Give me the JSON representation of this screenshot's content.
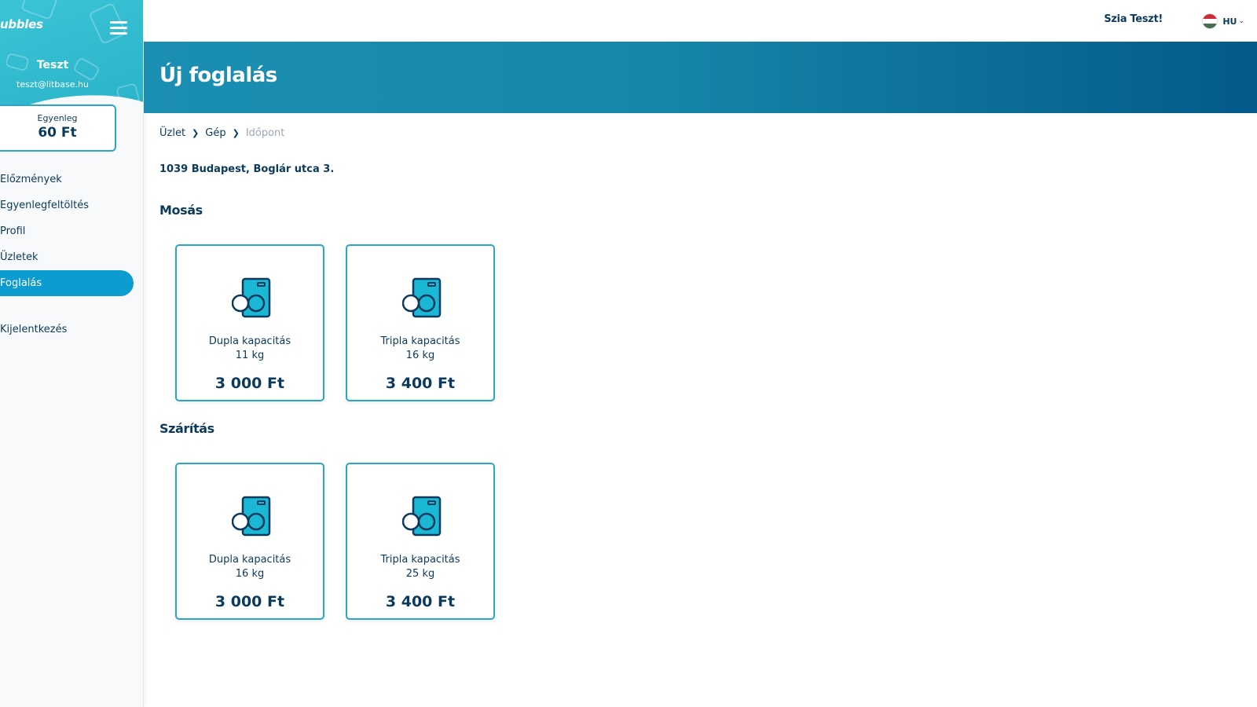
{
  "sidebar": {
    "logo": "ubbles",
    "user_name": "Teszt",
    "user_email": "teszt@litbase.hu",
    "balance_label": "Egyenleg",
    "balance_value": "60 Ft",
    "nav": [
      {
        "label": "Előzmények"
      },
      {
        "label": "Egyenlegfeltöltés"
      },
      {
        "label": "Profil"
      },
      {
        "label": "Üzletek"
      },
      {
        "label": "Foglalás"
      }
    ],
    "active": "Foglalás",
    "logout": "Kijelentkezés"
  },
  "header": {
    "greeting": "Szia Teszt!",
    "language": "HU",
    "flag_colors": [
      "#cd2a3e",
      "#ffffff",
      "#436f4d"
    ]
  },
  "banner": {
    "title": "Új foglalás"
  },
  "breadcrumb": [
    "Üzlet",
    "Gép",
    "Időpont"
  ],
  "address": "1039 Budapest, Boglár utca 3.",
  "sections": [
    {
      "title": "Mosás",
      "machines": [
        {
          "name": "Dupla kapacitás",
          "capacity": "11 kg",
          "price": "3 000 Ft",
          "icon": "washing-machine-icon"
        },
        {
          "name": "Tripla kapacitás",
          "capacity": "16 kg",
          "price": "3 400 Ft",
          "icon": "washing-machine-icon"
        }
      ]
    },
    {
      "title": "Szárítás",
      "machines": [
        {
          "name": "Dupla kapacitás",
          "capacity": "16 kg",
          "price": "3 000 Ft",
          "icon": "dryer-machine-icon"
        },
        {
          "name": "Tripla kapacitás",
          "capacity": "25 kg",
          "price": "3 400 Ft",
          "icon": "dryer-machine-icon"
        }
      ]
    }
  ],
  "colors": {
    "accent": "#0d9ccf",
    "text": "#0b3a5c",
    "card_border": "#29a6c9",
    "icon_fill": "#1bb8d6"
  }
}
